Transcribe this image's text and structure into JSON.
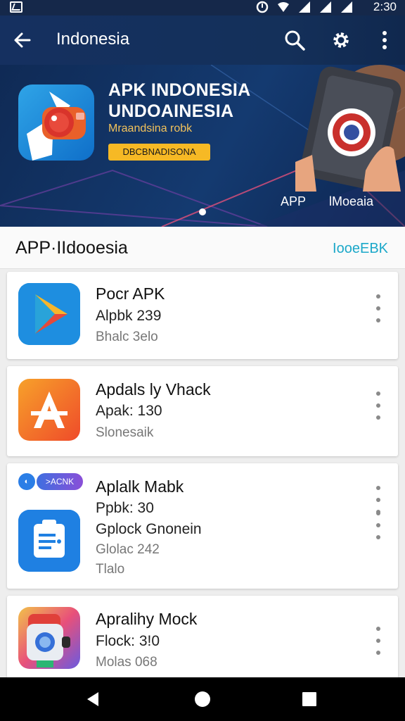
{
  "status_bar": {
    "time": "2:30"
  },
  "app_bar": {
    "title": "Indonesia",
    "icons": [
      "back-arrow-icon",
      "search-icon",
      "settings-icon",
      "more-vert-icon"
    ]
  },
  "banner": {
    "title_line1": "APK INDONESIA",
    "title_line2": "UNDOAINESIA",
    "subtitle": "Mraandsina robk",
    "button_label": "DBCBNADISONA",
    "label_left": "APP",
    "label_right": "lMoeaia"
  },
  "section": {
    "title": "APP·IIdooesia",
    "link": "IooeEBK"
  },
  "apps": [
    {
      "name": "Pocr APK",
      "line2": "Alpbk 239",
      "line3": "Bhalc 3elo",
      "icon": "play-store-icon"
    },
    {
      "name": "Apdals ly Vhack",
      "line2": "Apak: 130",
      "line3": "Slonesaik",
      "icon": "apk-a-icon"
    },
    {
      "name": "Aplalk Mabk",
      "line2": "Ppbk: 30",
      "line3": "Gplock Gnonein",
      "line4": "Glolac 242",
      "line5": "Tlalo",
      "badge": ">ACNK",
      "icon": "document-app-icon"
    },
    {
      "name": "Apralihy Mock",
      "line2": "Flock: 3!0",
      "line3": "Molas 068",
      "icon": "robot-app-icon"
    }
  ],
  "nav_bar": {
    "icons": [
      "back-triangle-icon",
      "home-circle-icon",
      "recents-square-icon"
    ]
  }
}
